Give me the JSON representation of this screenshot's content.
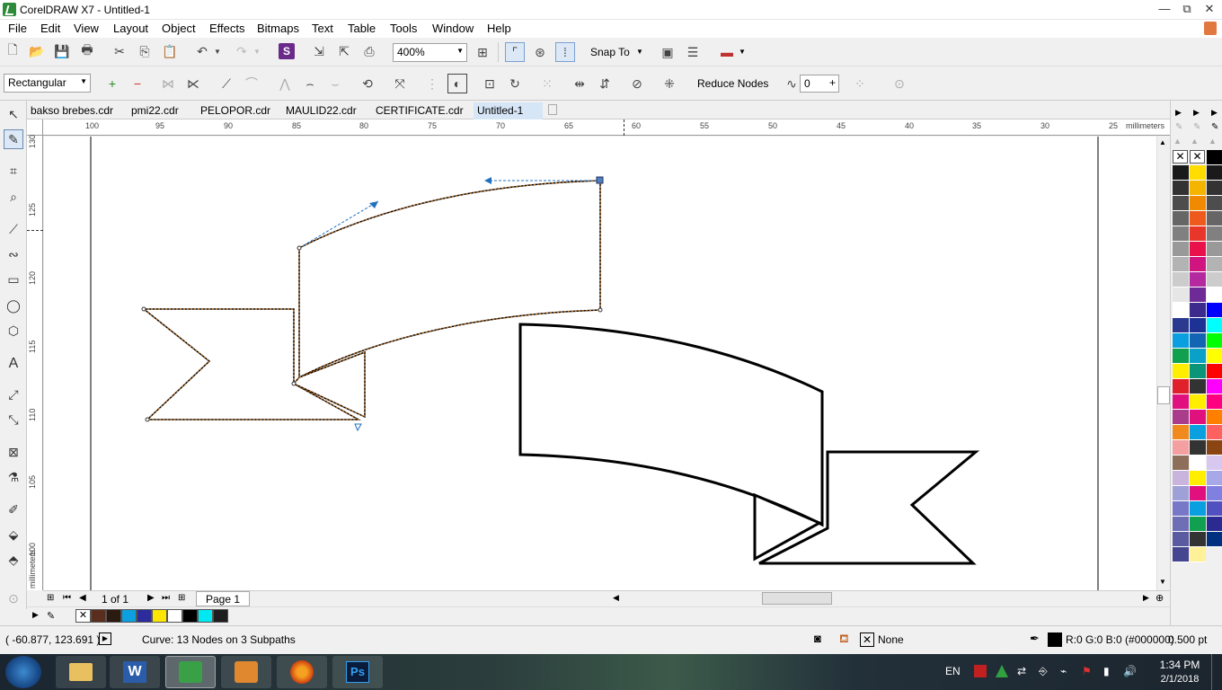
{
  "window": {
    "title": "CorelDRAW X7 - Untitled-1",
    "minimize": "—",
    "restore": "⧉",
    "close": "✕"
  },
  "menu": [
    "File",
    "Edit",
    "View",
    "Layout",
    "Object",
    "Effects",
    "Bitmaps",
    "Text",
    "Table",
    "Tools",
    "Window",
    "Help"
  ],
  "toolbar": {
    "zoom": "400%",
    "snap_to": "Snap To"
  },
  "property_bar": {
    "selection_mode": "Rectangular",
    "reduce_nodes": "Reduce Nodes",
    "curve_smoothness": "0"
  },
  "tabs": [
    "bakso brebes.cdr",
    "pmi22.cdr",
    "PELOPOR.cdr",
    "MAULID22.cdr",
    "CERTIFICATE.cdr",
    "Untitled-1"
  ],
  "active_tab": 5,
  "ruler": {
    "h_ticks": [
      "100",
      "95",
      "90",
      "85",
      "80",
      "75",
      "70",
      "65",
      "60",
      "55",
      "50",
      "45",
      "40",
      "35",
      "30",
      "25"
    ],
    "h_units": "millimeters",
    "v_ticks": [
      "130",
      "125",
      "120",
      "115",
      "110",
      "105",
      "100"
    ],
    "v_units": "millimeters"
  },
  "page_nav": {
    "page_count": "1 of 1",
    "page_tab": "Page 1"
  },
  "status": {
    "coords": "( -60.877, 123.691 )",
    "object_info": "Curve: 13 Nodes on 3 Subpaths",
    "fill": "None",
    "outline_color": "R:0 G:0 B:0 (#000000)",
    "outline_width": "0.500 pt"
  },
  "taskbar": {
    "lang": "EN",
    "time": "1:34 PM",
    "date": "2/1/2018"
  },
  "doc_palette": [
    "#5a2e1e",
    "#2a1a10",
    "#0ca0e0",
    "#2c2c9c",
    "#ffe600",
    "#ffffff",
    "#000000",
    "#00e8f0",
    "#1e1e1e"
  ],
  "palette_col1": [
    "#1a1a1a",
    "#333333",
    "#4d4d4d",
    "#666666",
    "#808080",
    "#999999",
    "#b3b3b3",
    "#cccccc",
    "#e6e6e6",
    "#ffffff",
    "#2b3a8f",
    "#0aa0e0",
    "#11a050",
    "#ffee00",
    "#e0202a",
    "#e0117f",
    "#aa3c8c",
    "#f08a1e",
    "#f4a0a0",
    "#8c6e5a",
    "#c8b4dc",
    "#a0a0d8",
    "#7878c8",
    "#6e6eb4",
    "#5a5aa0",
    "#464690"
  ],
  "palette_col2": [
    "#ffdd00",
    "#f5b400",
    "#f08a00",
    "#ee5a1e",
    "#e8362a",
    "#e8114a",
    "#d01480",
    "#b428a0",
    "#6e2a96",
    "#3c2a8c",
    "#1e3296",
    "#1464b4",
    "#0aa0c8",
    "#0a9478",
    "#333333",
    "#ffee00",
    "#e0117f",
    "#0aa0e0",
    "#333333",
    "#ffffff",
    "#ffee00",
    "#e0117f",
    "#0aa0e0",
    "#11a050",
    "#333333",
    "#fff09a"
  ],
  "palette_col3": [
    "#000000",
    "#1a1a1a",
    "#333333",
    "#4d4d4d",
    "#666666",
    "#808080",
    "#999999",
    "#b3b3b3",
    "#cccccc",
    "#ffffff",
    "#0000ff",
    "#00ffff",
    "#00ff00",
    "#ffff00",
    "#ff0000",
    "#ff00ff",
    "#ff0080",
    "#ff8000",
    "#ff6060",
    "#8b4513",
    "#d8c8f0",
    "#a8a8e8",
    "#8080e0",
    "#5050c0",
    "#2a2a90",
    "#003080"
  ]
}
